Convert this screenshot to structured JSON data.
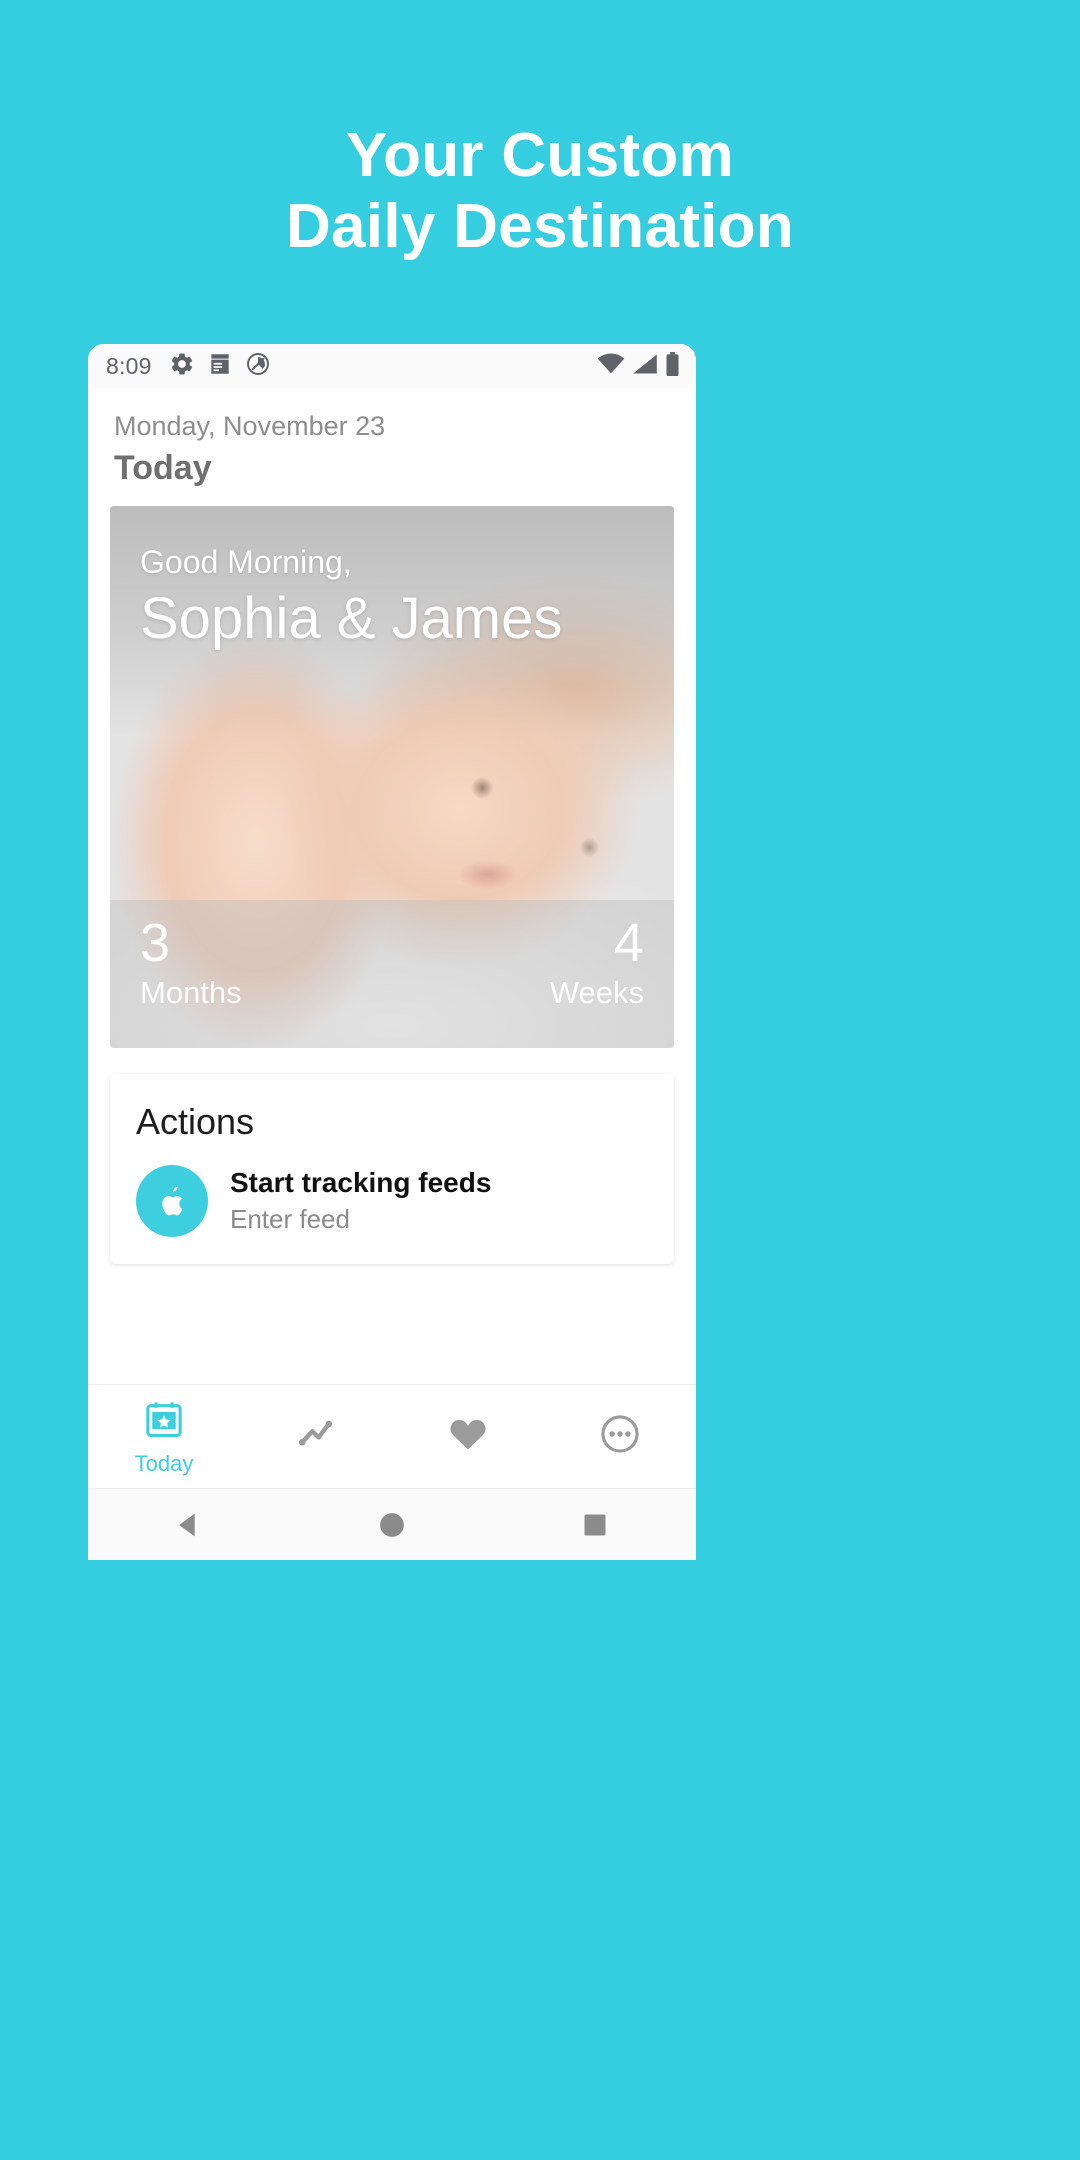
{
  "promo": {
    "line1": "Your Custom",
    "line2": "Daily Destination",
    "background_color": "#34cee0"
  },
  "phone": {
    "statusbar": {
      "time": "8:09",
      "left_icons": [
        "gear-icon",
        "notes-icon",
        "do-not-disturb-icon"
      ],
      "right_icons": [
        "wifi-icon",
        "cellular-signal-icon",
        "battery-icon"
      ]
    },
    "header": {
      "date": "Monday, November 23",
      "title": "Today"
    },
    "hero": {
      "greeting_small": "Good Morning,",
      "greeting_names": "Sophia & James",
      "stat_left": {
        "number": "3",
        "label": "Months"
      },
      "stat_right": {
        "number": "4",
        "label": "Weeks"
      },
      "avatars": [
        "baby-avatar",
        "mother-avatar"
      ]
    },
    "actions": {
      "title": "Actions",
      "items": [
        {
          "icon": "apple-icon",
          "icon_color": "#3dcfe0",
          "title": "Start tracking feeds",
          "subtitle": "Enter feed"
        }
      ]
    },
    "tabs": [
      {
        "icon": "calendar-star-icon",
        "label": "Today",
        "active": true
      },
      {
        "icon": "chart-line-icon",
        "label": "",
        "active": false
      },
      {
        "icon": "heart-icon",
        "label": "",
        "active": false
      },
      {
        "icon": "more-circle-icon",
        "label": "",
        "active": false
      }
    ],
    "system_nav": [
      "back-button",
      "home-button",
      "recents-button"
    ],
    "accent_color": "#3dcfe0",
    "inactive_color": "#9b9b9b"
  }
}
